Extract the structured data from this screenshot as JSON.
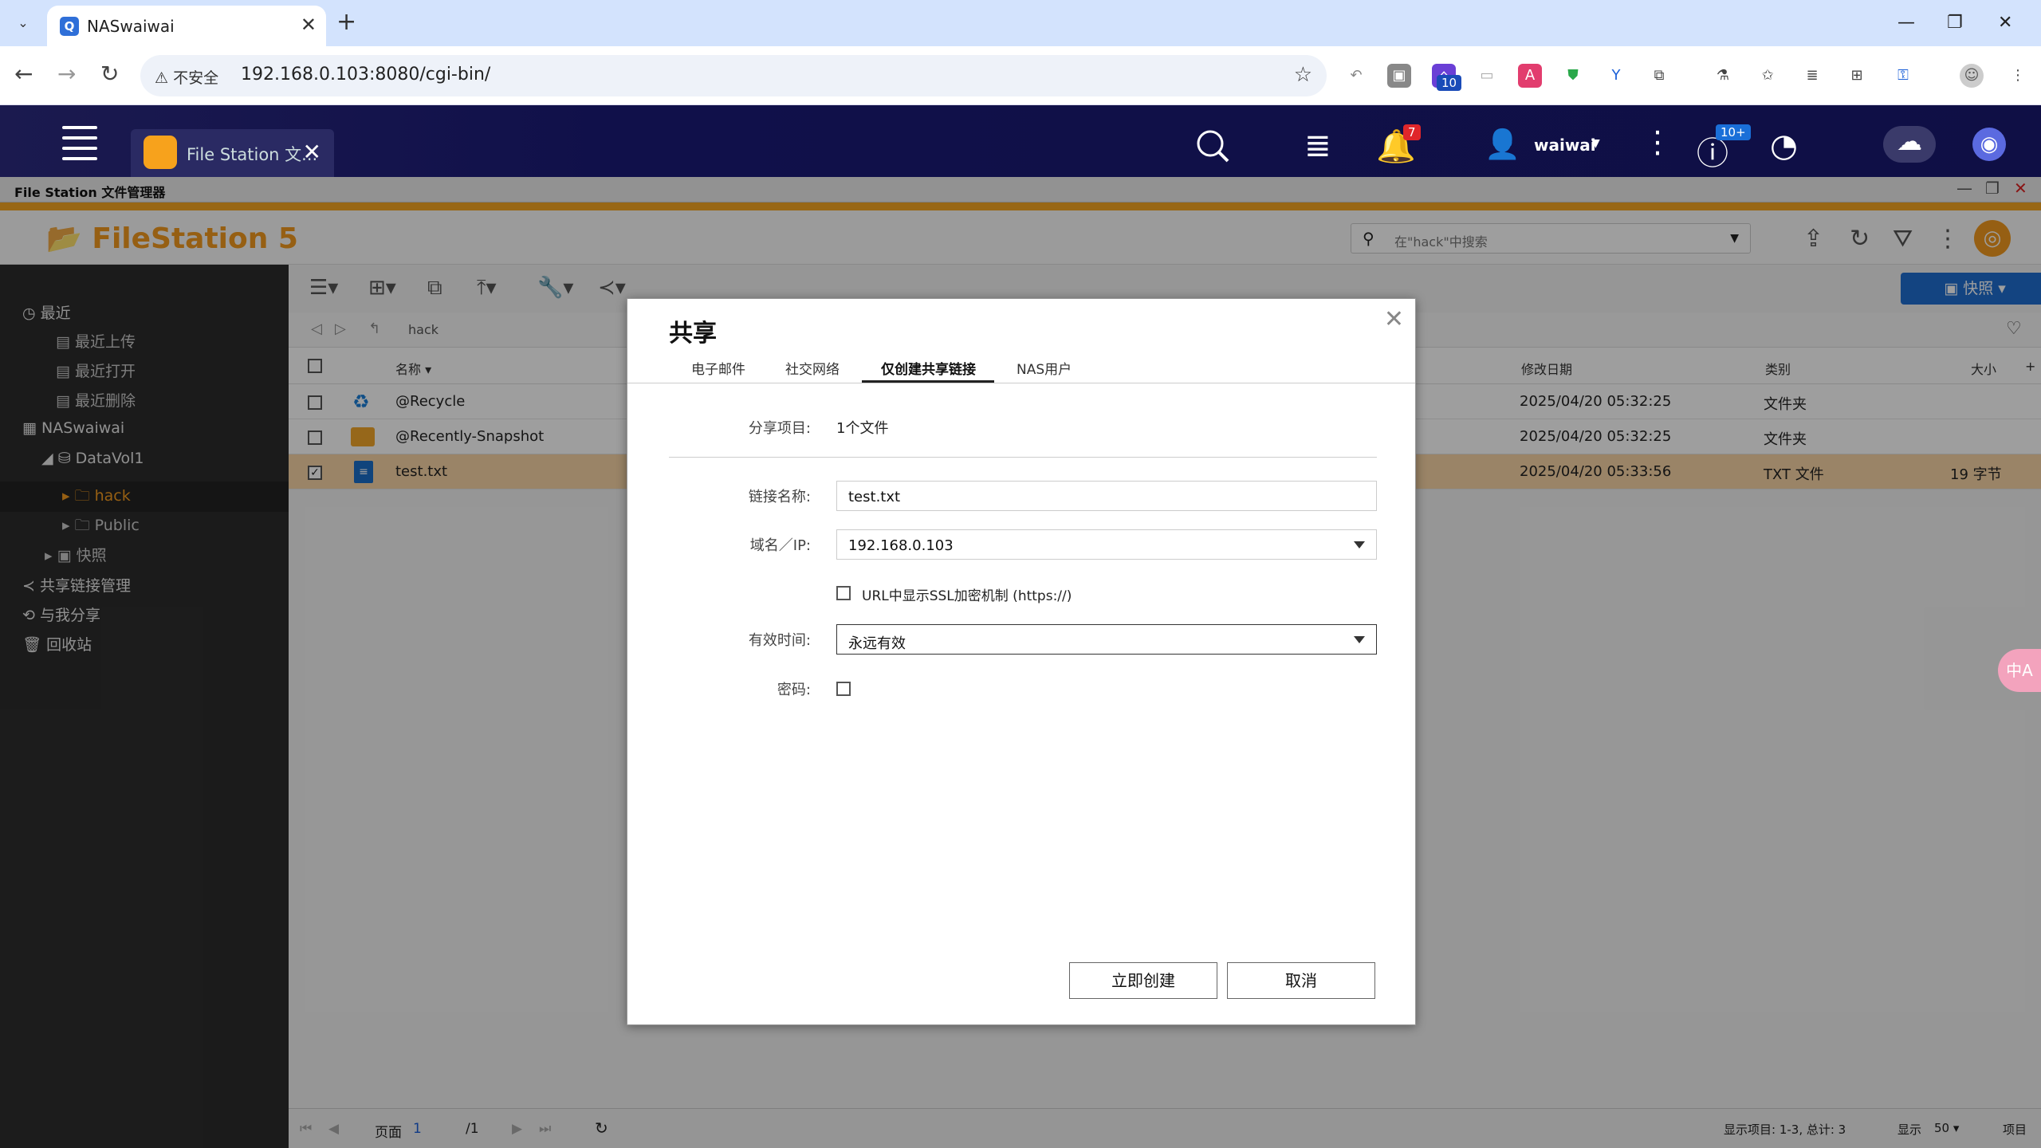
{
  "browser": {
    "tab_title": "NASwaiwai",
    "security_label": "不安全",
    "url": "192.168.0.103:8080/cgi-bin/",
    "extension_badge": "10"
  },
  "qts": {
    "app_tab_label": "File Station 文...",
    "user": "waiwai",
    "notification_count": "7",
    "update_count": "10+"
  },
  "window": {
    "title": "File Station 文件管理器",
    "logo": "FileStation 5",
    "search_placeholder": "在\"hack\"中搜索",
    "snapshot_button": "快照"
  },
  "sidebar": {
    "recent": "最近",
    "recent_upload": "最近上传",
    "recent_open": "最近打开",
    "recent_delete": "最近删除",
    "nas": "NASwaiwai",
    "datavol": "DataVol1",
    "hack": "hack",
    "public": "Public",
    "snapshot": "快照",
    "share_links": "共享链接管理",
    "shared_with_me": "与我分享",
    "recycle": "回收站"
  },
  "breadcrumb": "hack",
  "table": {
    "headers": {
      "name": "名称",
      "modified": "修改日期",
      "type": "类别",
      "size": "大小"
    },
    "rows": [
      {
        "name": "@Recycle",
        "modified": "2025/04/20 05:32:25",
        "type": "文件夹",
        "size": ""
      },
      {
        "name": "@Recently-Snapshot",
        "modified": "2025/04/20 05:32:25",
        "type": "文件夹",
        "size": ""
      },
      {
        "name": "test.txt",
        "modified": "2025/04/20 05:33:56",
        "type": "TXT 文件",
        "size": "19 字节"
      }
    ]
  },
  "pager": {
    "page_label": "页面",
    "page": "1",
    "total_pages": "/1",
    "display_items": "显示项目: 1-3, 总计: 3",
    "show_label": "显示",
    "per_page": "50",
    "items_label": "项目"
  },
  "dialog": {
    "title": "共享",
    "tabs": [
      "电子邮件",
      "社交网络",
      "仅创建共享链接",
      "NAS用户"
    ],
    "active_tab": 2,
    "share_item_label": "分享项目:",
    "share_item_value": "1个文件",
    "link_name_label": "链接名称:",
    "link_name_value": "test.txt",
    "domain_label": "域名／IP:",
    "domain_value": "192.168.0.103",
    "ssl_label": "URL中显示SSL加密机制 (https://)",
    "ssl_checked": false,
    "expire_label": "有效时间:",
    "expire_value": "永远有效",
    "password_label": "密码:",
    "password_checked": false,
    "create_button": "立即创建",
    "cancel_button": "取消"
  },
  "translate_fab": "中A",
  "colors": {
    "accent": "#f5a623",
    "selected_row": "#f9d6a6",
    "header_bg": "#10104a",
    "sidebar_bg": "#2d2d2d",
    "snapshot_btn": "#1f6fd1"
  }
}
